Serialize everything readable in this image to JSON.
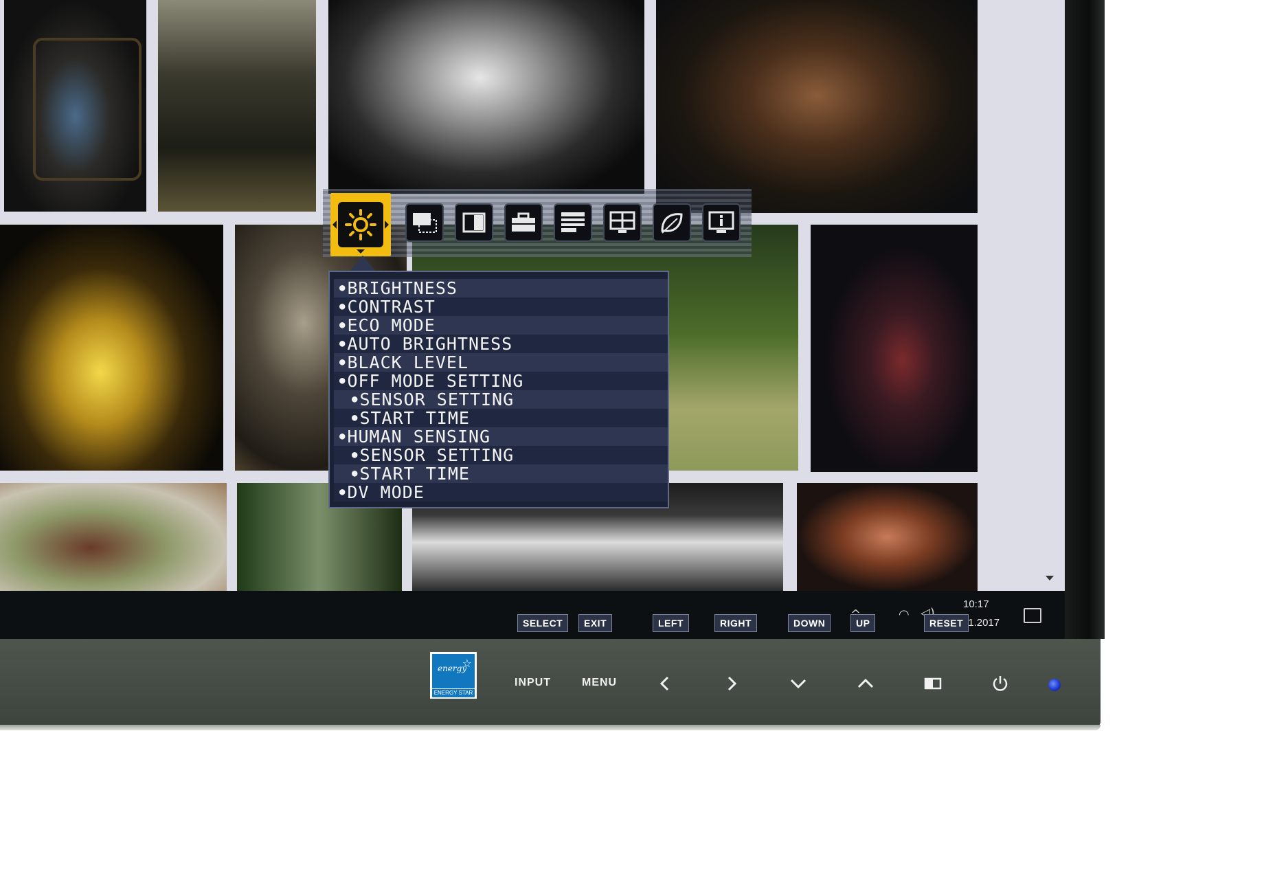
{
  "taskbar": {
    "time": "10:17",
    "date": "11.2017"
  },
  "key_guide": {
    "select": "SELECT",
    "exit": "EXIT",
    "left": "LEFT",
    "right": "RIGHT",
    "down": "DOWN",
    "up": "UP",
    "reset": "RESET"
  },
  "osd": {
    "tabs": [
      {
        "icon": "brightness-sun-icon",
        "active": true
      },
      {
        "icon": "screen-size-icon",
        "active": false
      },
      {
        "icon": "color-icon",
        "active": false
      },
      {
        "icon": "toolbox-icon",
        "active": false
      },
      {
        "icon": "menu-tools-icon",
        "active": false
      },
      {
        "icon": "multi-picture-icon",
        "active": false
      },
      {
        "icon": "eco-leaf-icon",
        "active": false
      },
      {
        "icon": "information-icon",
        "active": false
      }
    ],
    "items": [
      {
        "label": "BRIGHTNESS",
        "sub": false
      },
      {
        "label": "CONTRAST",
        "sub": false
      },
      {
        "label": "ECO MODE",
        "sub": false
      },
      {
        "label": "AUTO BRIGHTNESS",
        "sub": false
      },
      {
        "label": "BLACK LEVEL",
        "sub": false
      },
      {
        "label": "OFF MODE SETTING",
        "sub": false
      },
      {
        "label": "SENSOR SETTING",
        "sub": true
      },
      {
        "label": "START TIME",
        "sub": true
      },
      {
        "label": "HUMAN SENSING",
        "sub": false
      },
      {
        "label": "SENSOR SETTING",
        "sub": true
      },
      {
        "label": "START TIME",
        "sub": true
      },
      {
        "label": "DV MODE",
        "sub": false
      }
    ],
    "accent_color": "#f2bd10"
  },
  "front_panel": {
    "energy_star": "ENERGY STAR",
    "energy_script": "energy",
    "input": "INPUT",
    "menu": "MENU"
  }
}
